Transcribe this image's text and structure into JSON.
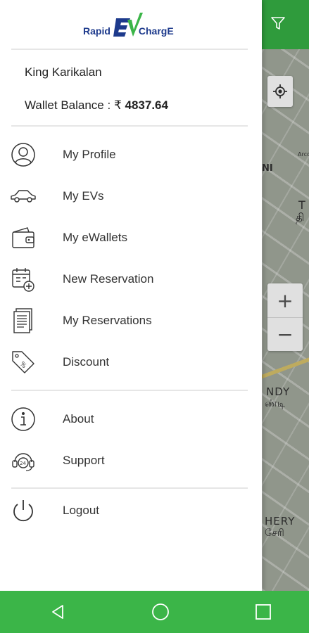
{
  "logo": {
    "word_left": "Rapid",
    "word_mid": "EV",
    "word_right": "ChargE"
  },
  "user": {
    "name": "King Karikalan",
    "wallet_label": "Wallet Balance : ",
    "currency": "₹",
    "wallet_amount": "4837.64"
  },
  "menu": {
    "primary": [
      {
        "label": "My Profile",
        "icon": "profile-icon"
      },
      {
        "label": "My EVs",
        "icon": "car-icon"
      },
      {
        "label": "My eWallets",
        "icon": "wallet-icon"
      },
      {
        "label": "New Reservation",
        "icon": "calendar-add-icon"
      },
      {
        "label": "My Reservations",
        "icon": "document-list-icon"
      },
      {
        "label": "Discount",
        "icon": "discount-tag-icon"
      }
    ],
    "secondary": [
      {
        "label": "About",
        "icon": "info-icon"
      },
      {
        "label": "Support",
        "icon": "support-24-icon"
      }
    ],
    "logout": {
      "label": "Logout",
      "icon": "power-icon"
    }
  },
  "map": {
    "labels": {
      "arcot": "Arcot Rd",
      "ni": "NI",
      "t": "T",
      "tamil_thi": "தி",
      "andy": "NDY",
      "tamil_andy": "ண்டி",
      "hery": "HERY",
      "tamil_hery": "சேரி"
    },
    "zoom_in": "+",
    "zoom_out": "−"
  },
  "colors": {
    "brand_green": "#3bb548",
    "topbar_green": "#2f9b3c",
    "brand_blue": "#1d3a8c"
  }
}
